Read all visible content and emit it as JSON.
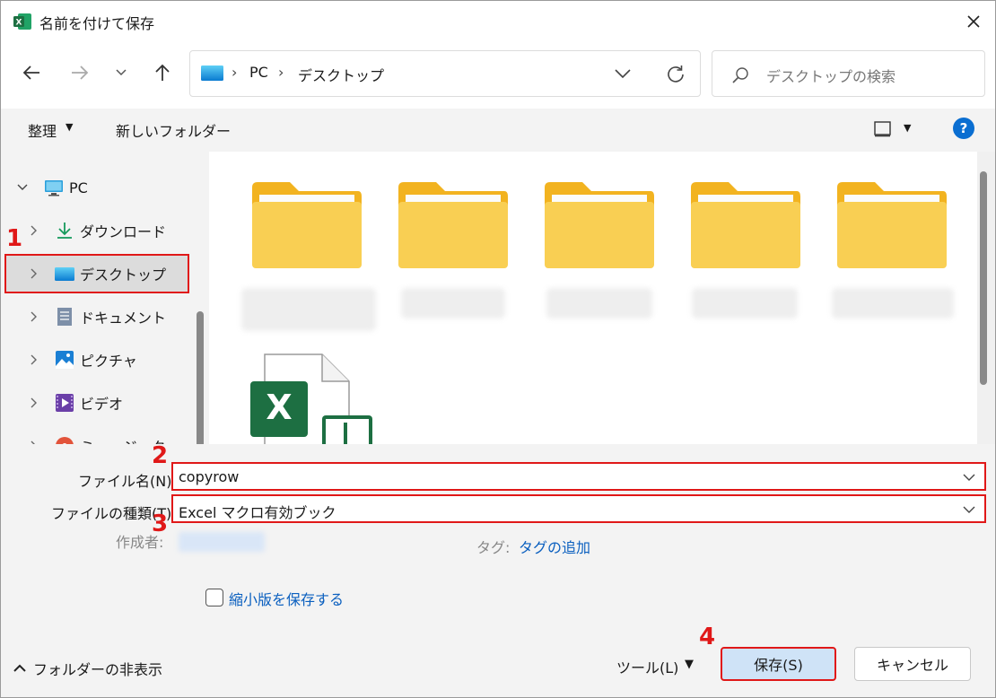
{
  "window": {
    "title": "名前を付けて保存"
  },
  "address_bar": {
    "segments": [
      "PC",
      "デスクトップ"
    ]
  },
  "search": {
    "placeholder": "デスクトップの検索"
  },
  "command_bar": {
    "organize_label": "整理",
    "new_folder_label": "新しいフォルダー"
  },
  "nav_tree": {
    "items": [
      {
        "label": "PC",
        "icon": "pc-icon",
        "expanded": true
      },
      {
        "label": "ダウンロード",
        "icon": "download-icon"
      },
      {
        "label": "デスクトップ",
        "icon": "desktop-icon",
        "selected": true
      },
      {
        "label": "ドキュメント",
        "icon": "document-icon"
      },
      {
        "label": "ピクチャ",
        "icon": "picture-icon"
      },
      {
        "label": "ビデオ",
        "icon": "video-icon"
      },
      {
        "label": "ミュージック",
        "icon": "music-icon"
      }
    ]
  },
  "files": {
    "folder_count": 5,
    "excel_file": true
  },
  "form": {
    "filename_label": "ファイル名(N):",
    "filename_value": "copyrow",
    "filetype_label": "ファイルの種類(T):",
    "filetype_value": "Excel マクロ有効ブック",
    "author_label": "作成者:",
    "tag_label": "タグ:",
    "tag_link": "タグの追加",
    "thumbnail_label": "縮小版を保存する",
    "thumbnail_checked": false
  },
  "footer": {
    "hide_folders_label": "フォルダーの非表示",
    "tools_label": "ツール(L)",
    "save_label": "保存(S)",
    "cancel_label": "キャンセル"
  },
  "annotations": {
    "step1": "1",
    "step2": "2",
    "step3": "3",
    "step4": "4"
  },
  "colors": {
    "highlight_red": "#e01818",
    "link_blue": "#0a5fbf",
    "folder_yellow": "#f7c948",
    "excel_green": "#1d6f42"
  }
}
